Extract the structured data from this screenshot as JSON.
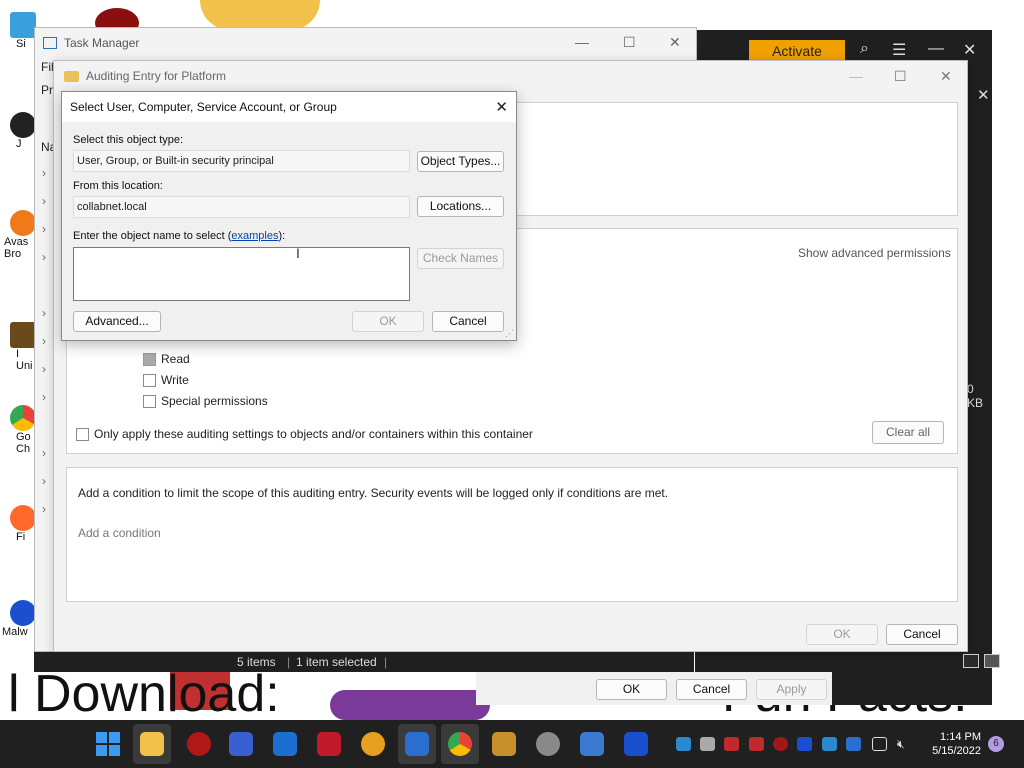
{
  "desktop": {
    "icons": [
      {
        "label": "Si"
      },
      {
        "label": "J"
      },
      {
        "label": "Avas\nBro"
      },
      {
        "label": "I\nUni"
      },
      {
        "label": "Go\nCh"
      },
      {
        "label": "Fi"
      },
      {
        "label": "Malw"
      }
    ],
    "caption_left": "l Download:",
    "caption_right": "Fun Facts!"
  },
  "dark_app": {
    "activate_label": "Activate",
    "size_text": "0 KB"
  },
  "task_manager": {
    "title": "Task Manager",
    "menu_file": "Fil",
    "tab_processes": "Pr",
    "tab_name": "Na"
  },
  "audit_window": {
    "title": "Auditing Entry for Platform",
    "show_advanced": "Show advanced permissions",
    "permissions": [
      {
        "label": "Read",
        "checked": true
      },
      {
        "label": "Write",
        "checked": false
      },
      {
        "label": "Special permissions",
        "checked": false
      }
    ],
    "only_apply_label": "Only apply these auditing settings to objects and/or containers within this container",
    "clear_all": "Clear all",
    "condition_text": "Add a condition to limit the scope of this auditing entry. Security events will be logged only if conditions are met.",
    "add_condition": "Add a condition",
    "ok": "OK",
    "cancel": "Cancel"
  },
  "dialog": {
    "title": "Select User, Computer, Service Account, or Group",
    "object_type_label": "Select this object type:",
    "object_type_value": "User, Group, or Built-in security principal",
    "object_types_btn": "Object Types...",
    "location_label": "From this location:",
    "location_value": "collabnet.local",
    "locations_btn": "Locations...",
    "enter_name_prefix": "Enter the object name to select (",
    "examples_link": "examples",
    "enter_name_suffix": "):",
    "object_name_value": "",
    "check_names_btn": "Check Names",
    "advanced_btn": "Advanced...",
    "ok_btn": "OK",
    "cancel_btn": "Cancel"
  },
  "explorer_status": {
    "items": "5 items",
    "selected": "1 item selected"
  },
  "properties_buttons": {
    "ok": "OK",
    "cancel": "Cancel",
    "apply": "Apply"
  },
  "taskbar": {
    "time": "1:14 PM",
    "date": "5/15/2022",
    "notification_count": "6"
  }
}
